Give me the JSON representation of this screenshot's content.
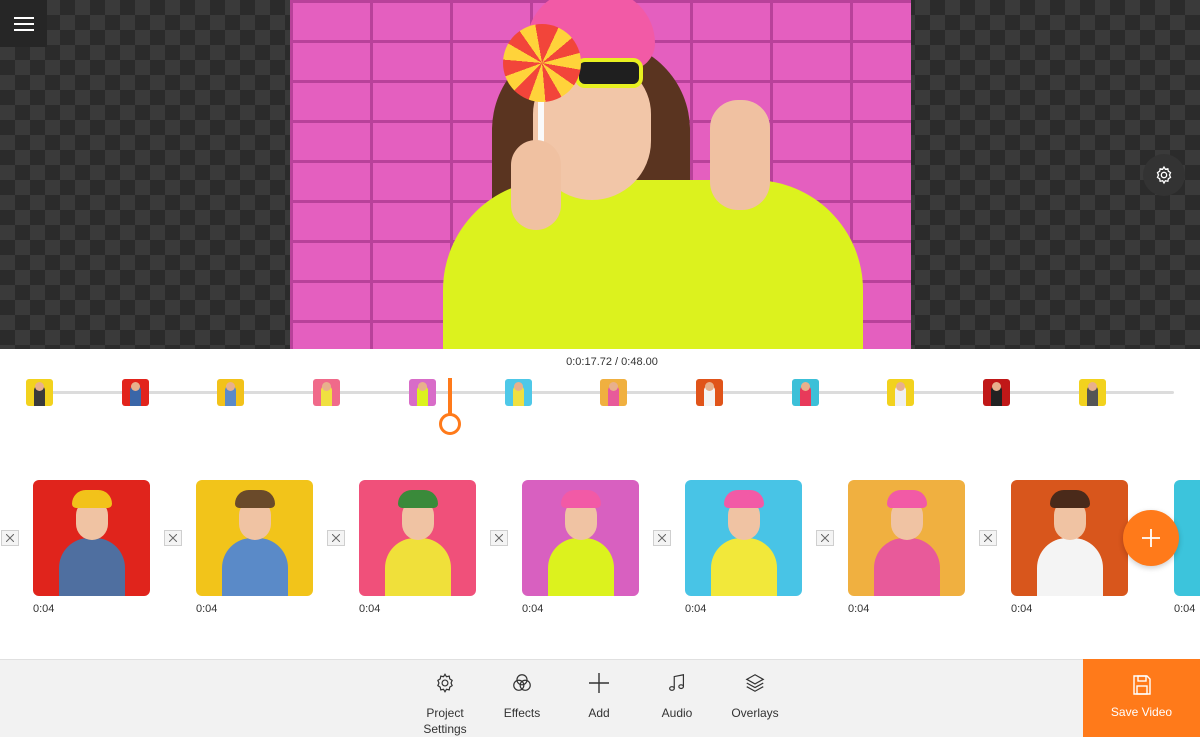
{
  "playback": {
    "timecode": "0:0:17.72 / 0:48.00"
  },
  "timeline_thumbs": [
    {
      "bg": "#f2d21e",
      "fg": "#3a3a3a"
    },
    {
      "bg": "#e2241c",
      "fg": "#3a66a8"
    },
    {
      "bg": "#f2c21a",
      "fg": "#5a8ac8"
    },
    {
      "bg": "#f06a8a",
      "fg": "#f0e040"
    },
    {
      "bg": "#d86cc8",
      "fg": "#dcf21e"
    },
    {
      "bg": "#4ec8e8",
      "fg": "#f0e040"
    },
    {
      "bg": "#f0b040",
      "fg": "#e85a9a"
    },
    {
      "bg": "#e0541a",
      "fg": "#f4f4f4"
    },
    {
      "bg": "#3cc0d8",
      "fg": "#e83a5a"
    },
    {
      "bg": "#f2d21e",
      "fg": "#f0f0f0"
    },
    {
      "bg": "#c01818",
      "fg": "#222222"
    },
    {
      "bg": "#f2d21e",
      "fg": "#555555"
    }
  ],
  "clips": [
    {
      "duration": "0:04",
      "bg": "#e0241c",
      "body": "#4f6fa0",
      "hat": "#f2c21a"
    },
    {
      "duration": "0:04",
      "bg": "#f2c41a",
      "body": "#5a8ac8",
      "hat": "#6a4a2a"
    },
    {
      "duration": "0:04",
      "bg": "#f0507a",
      "body": "#f0e03a",
      "hat": "#3a8a3a"
    },
    {
      "duration": "0:04",
      "bg": "#d860c0",
      "body": "#dcf21e",
      "hat": "#f25aa6"
    },
    {
      "duration": "0:04",
      "bg": "#48c4e6",
      "body": "#f2e83a",
      "hat": "#f25aa6"
    },
    {
      "duration": "0:04",
      "bg": "#f0b040",
      "body": "#e85a9a",
      "hat": "#f25aa6"
    },
    {
      "duration": "0:04",
      "bg": "#d8561c",
      "body": "#f4f4f4",
      "hat": "#4a2a1a"
    },
    {
      "duration": "0:04",
      "bg": "#3cc4dc",
      "body": "#e83a5a",
      "hat": "#4a2a1a"
    }
  ],
  "toolbar": {
    "project_settings": "Project\nSettings",
    "effects": "Effects",
    "add": "Add",
    "audio": "Audio",
    "overlays": "Overlays",
    "save_video": "Save Video"
  },
  "colors": {
    "accent": "#ff7a1a"
  },
  "icons": {
    "menu": "hamburger-icon",
    "preview_settings": "gear-icon",
    "add_clip": "plus-icon",
    "remove_clip": "close-icon",
    "save": "floppy-disk-icon"
  }
}
